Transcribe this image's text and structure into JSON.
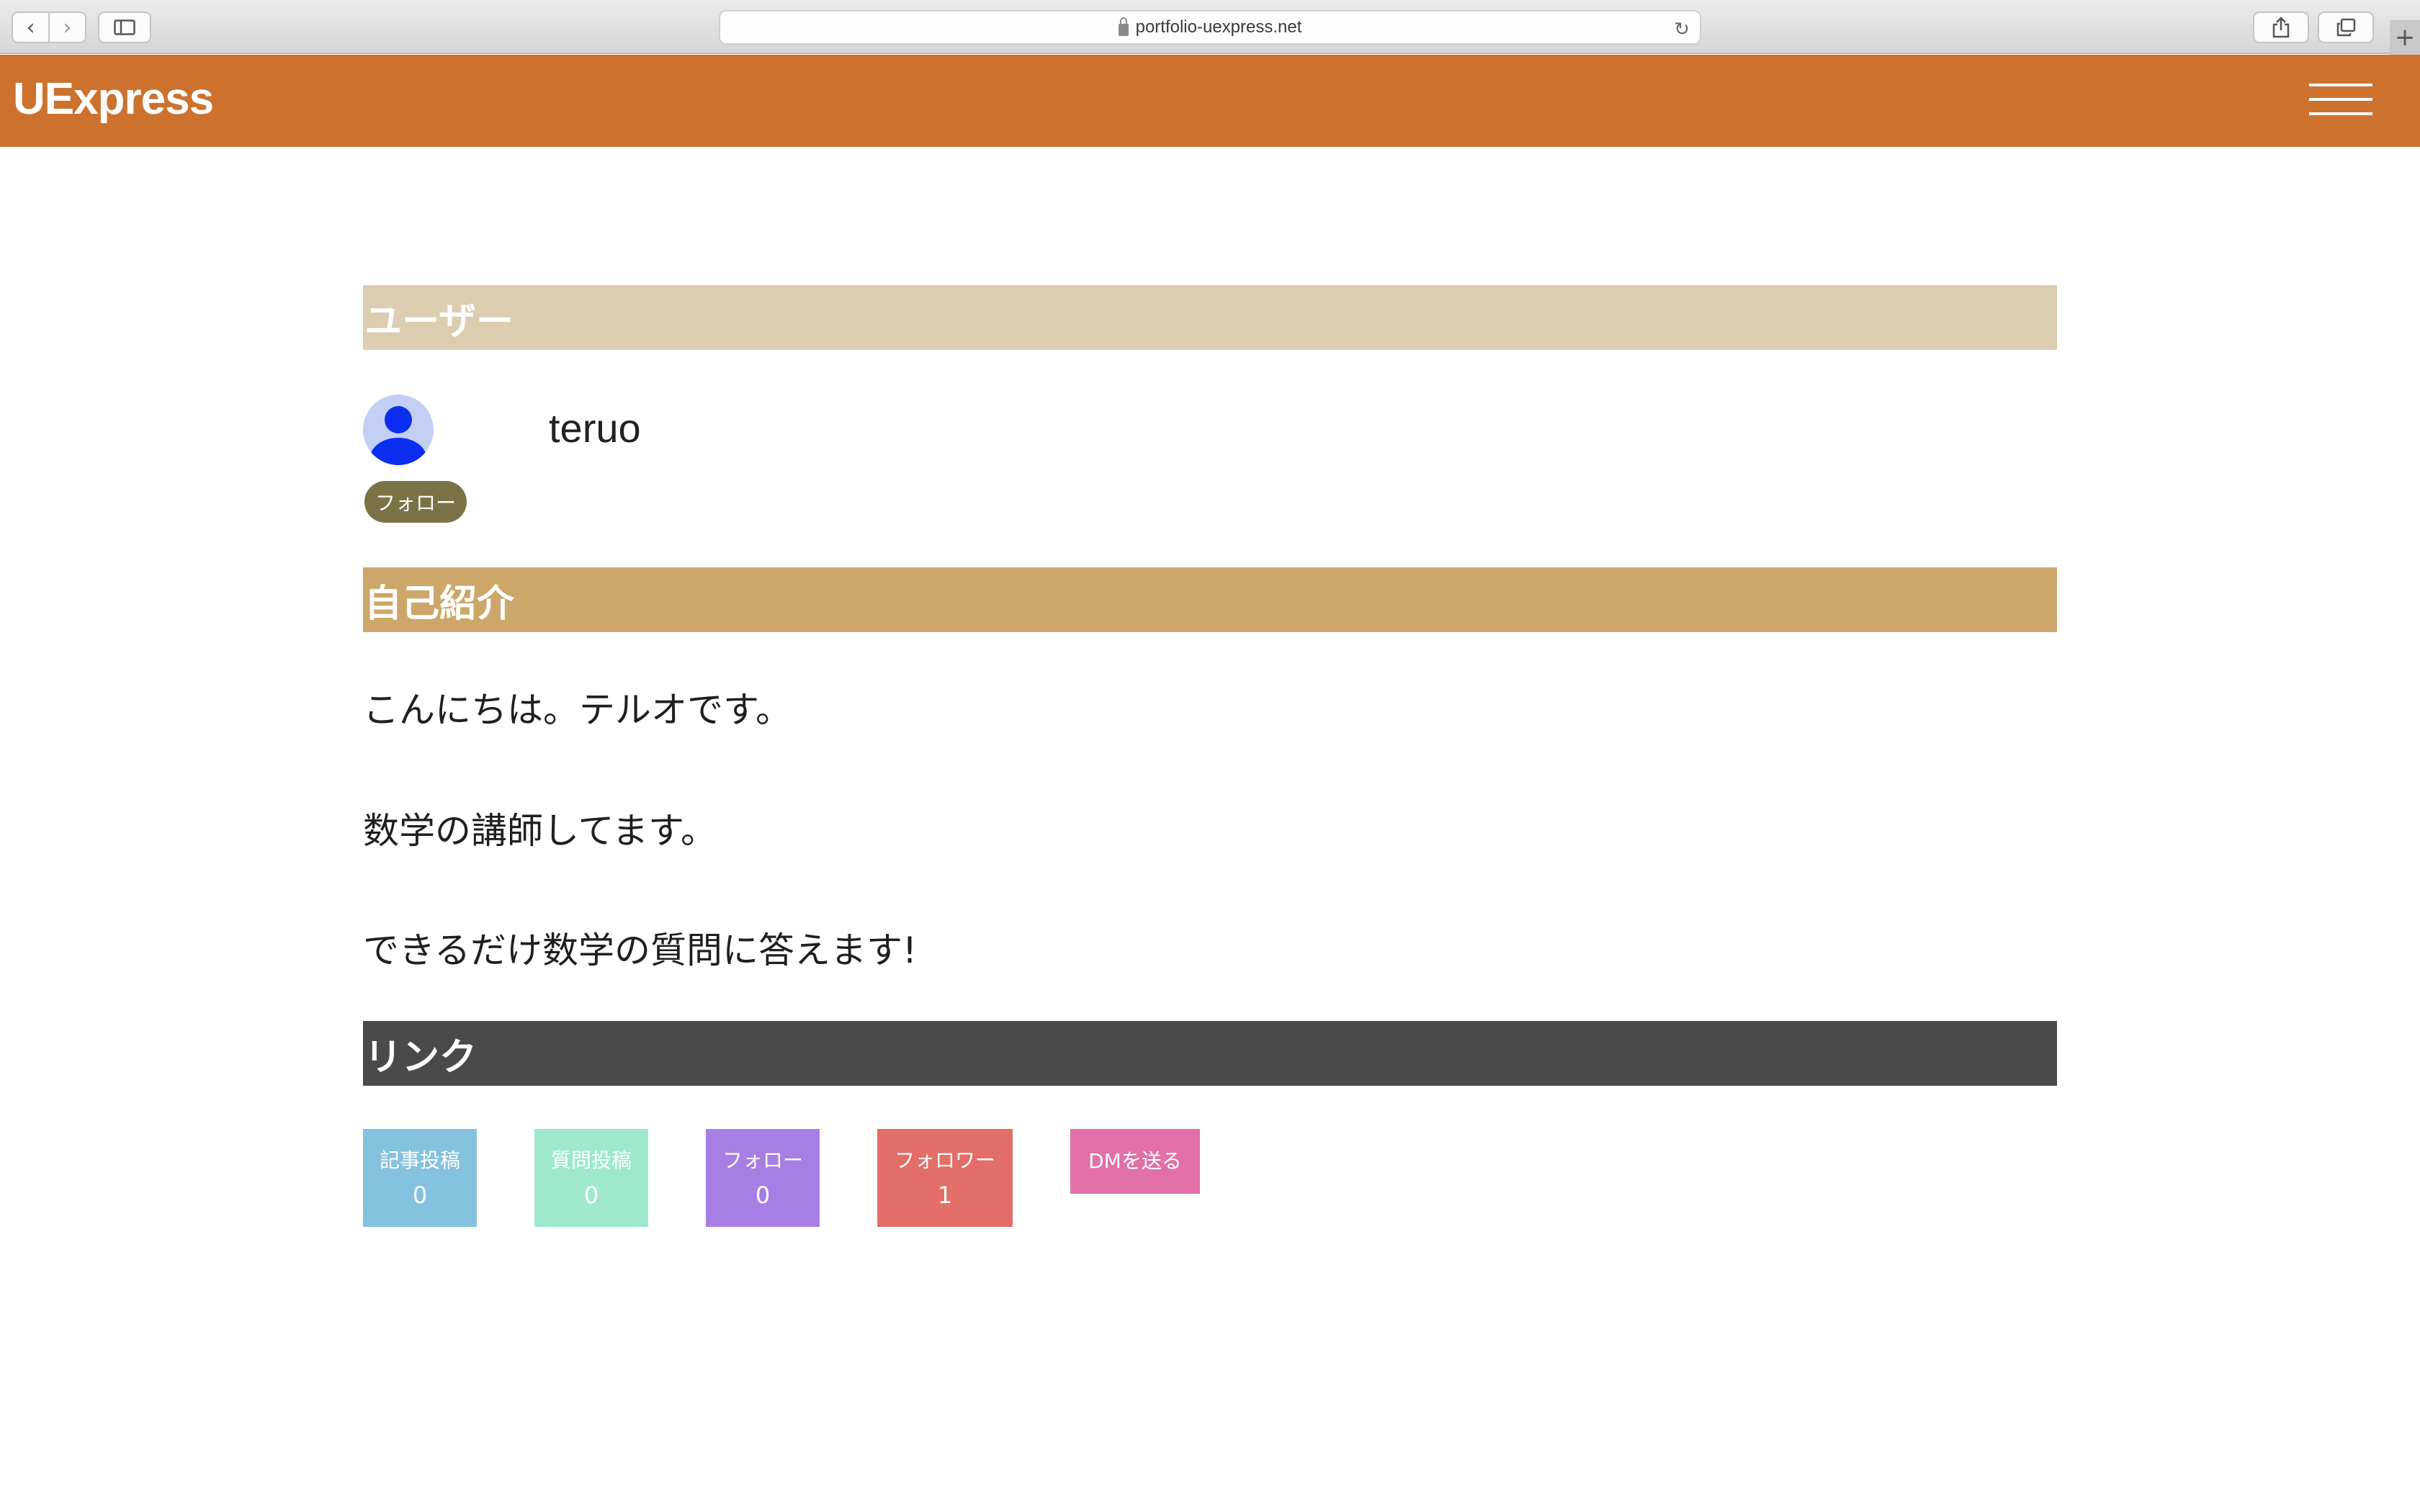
{
  "browser": {
    "url": "portfolio-uexpress.net",
    "back_glyph": "‹",
    "forward_glyph": "›",
    "reload_glyph": "↻",
    "newtab_glyph": "+"
  },
  "header": {
    "brand": "UExpress",
    "color": "#cc722e"
  },
  "sections": {
    "user": {
      "title": "ユーザー",
      "color": "#dccdb0"
    },
    "intro": {
      "title": "自己紹介",
      "color": "#cda769"
    },
    "links": {
      "title": "リンク",
      "color": "#4a4a4a"
    }
  },
  "profile": {
    "username": "teruo",
    "follow_label": "フォロー"
  },
  "intro_lines": [
    "こんにちは。テルオです。",
    "数学の講師してます。",
    "できるだけ数学の質問に答えます!"
  ],
  "links": [
    {
      "label": "記事投稿",
      "count": "0",
      "color": "#84c2df"
    },
    {
      "label": "質問投稿",
      "count": "0",
      "color": "#9ee9cc"
    },
    {
      "label": "フォロー",
      "count": "0",
      "color": "#a77ee4"
    },
    {
      "label": "フォロワー",
      "count": "1",
      "color": "#e36e68"
    },
    {
      "label": "DMを送る",
      "color": "#e070a5"
    }
  ]
}
